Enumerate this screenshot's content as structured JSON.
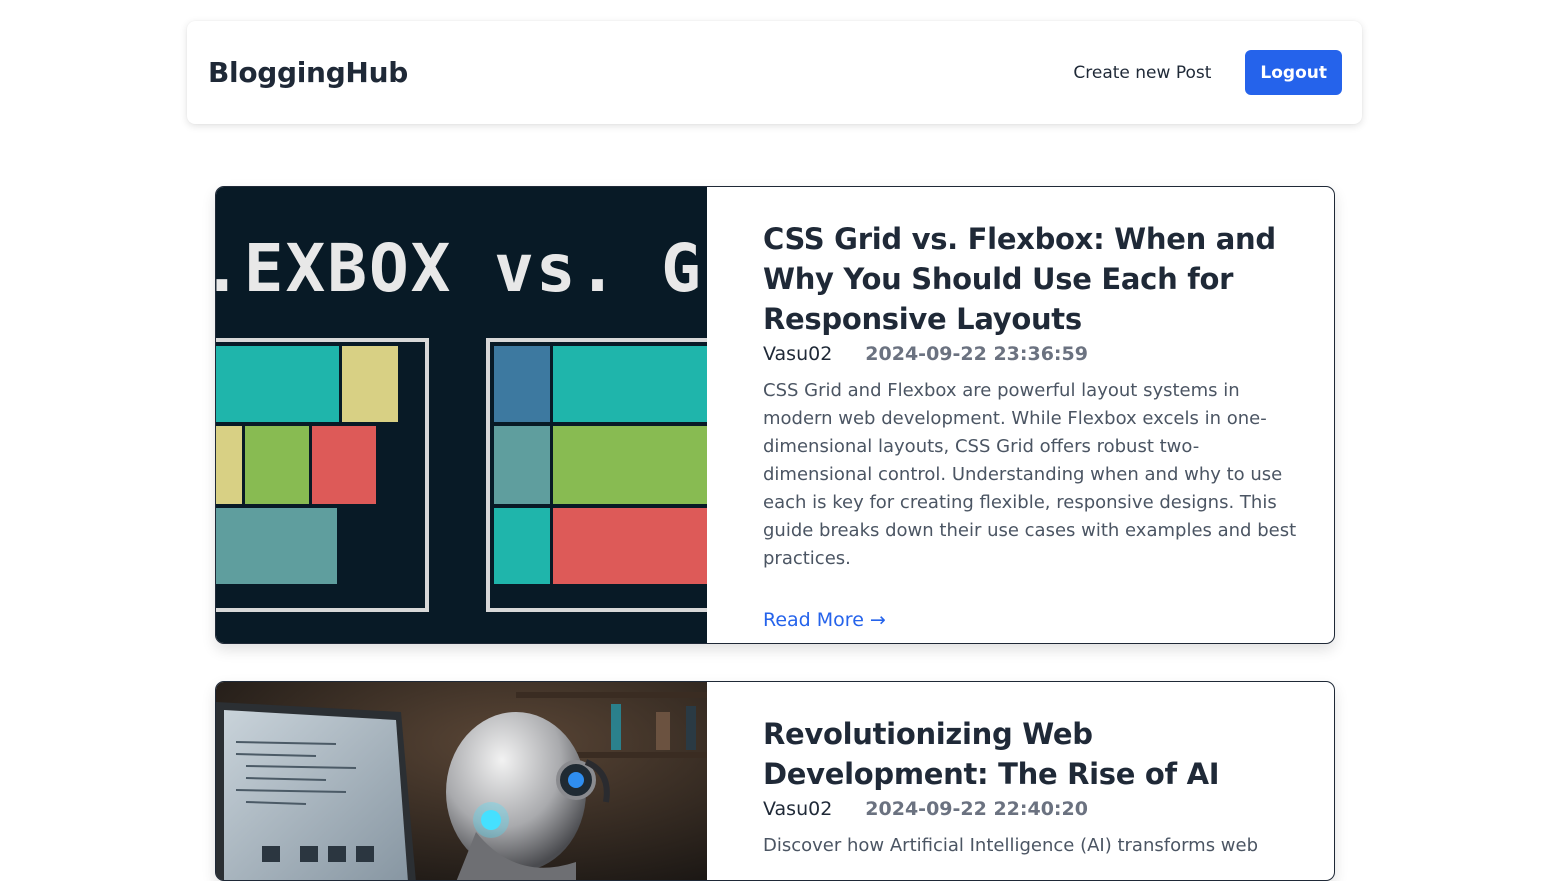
{
  "nav": {
    "brand": "BloggingHub",
    "create_label": "Create new Post",
    "logout_label": "Logout"
  },
  "posts": [
    {
      "title": "CSS Grid vs. Flexbox: When and Why You Should Use Each for Responsive Layouts",
      "author": "Vasu02",
      "date": "2024-09-22 23:36:59",
      "excerpt": "CSS Grid and Flexbox are powerful layout systems in modern web development. While Flexbox excels in one-dimensional layouts, CSS Grid offers robust two-dimensional control. Understanding when and why to use each is key for creating flexible, responsive designs. This guide breaks down their use cases with examples and best practices.",
      "read_more": "Read More →",
      "image_text": ".EXBOX vs. GRI"
    },
    {
      "title": "Revolutionizing Web Development: The Rise of AI",
      "author": "Vasu02",
      "date": "2024-09-22 22:40:20",
      "excerpt": "Discover how Artificial Intelligence (AI) transforms web"
    }
  ],
  "colors": {
    "accent": "#2563eb",
    "text": "#1f2937",
    "muted": "#6b7280"
  }
}
